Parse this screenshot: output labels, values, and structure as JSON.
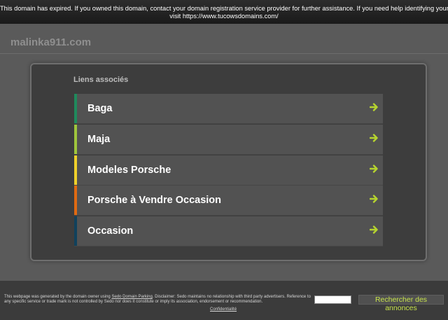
{
  "notice": {
    "line1": "This domain has expired. If you owned this domain, contact your domain registration service provider for further assistance. If you need help identifying your provider,",
    "line2": "visit https://www.tucowsdomains.com/"
  },
  "domain_name": "malinka911.com",
  "related_links": {
    "heading": "Liens associés",
    "items": [
      {
        "label": "Baga",
        "accent": "#1f8a5c"
      },
      {
        "label": "Maja",
        "accent": "#9fc63c"
      },
      {
        "label": "Modeles Porsche",
        "accent": "#f0d12a"
      },
      {
        "label": "Porsche à Vendre Occasion",
        "accent": "#e06a12"
      },
      {
        "label": "Occasion",
        "accent": "#10415c"
      }
    ],
    "arrow_icon": "arrow-right-icon",
    "arrow_color": "#b6d42e"
  },
  "footer": {
    "disclaimer_part1": "This webpage was generated by the domain owner using ",
    "disclaimer_link": "Sedo Domain Parking",
    "disclaimer_part2": ". Disclaimer: Sedo maintains no relationship with third party advertisers. Reference to any specific service or trade mark is not controlled by Sedo nor does it constitute or imply its association, endorsement or recommendation.",
    "privacy_label": "Confidentialité",
    "search_placeholder": "",
    "search_button_label": "Rechercher des annonces"
  }
}
